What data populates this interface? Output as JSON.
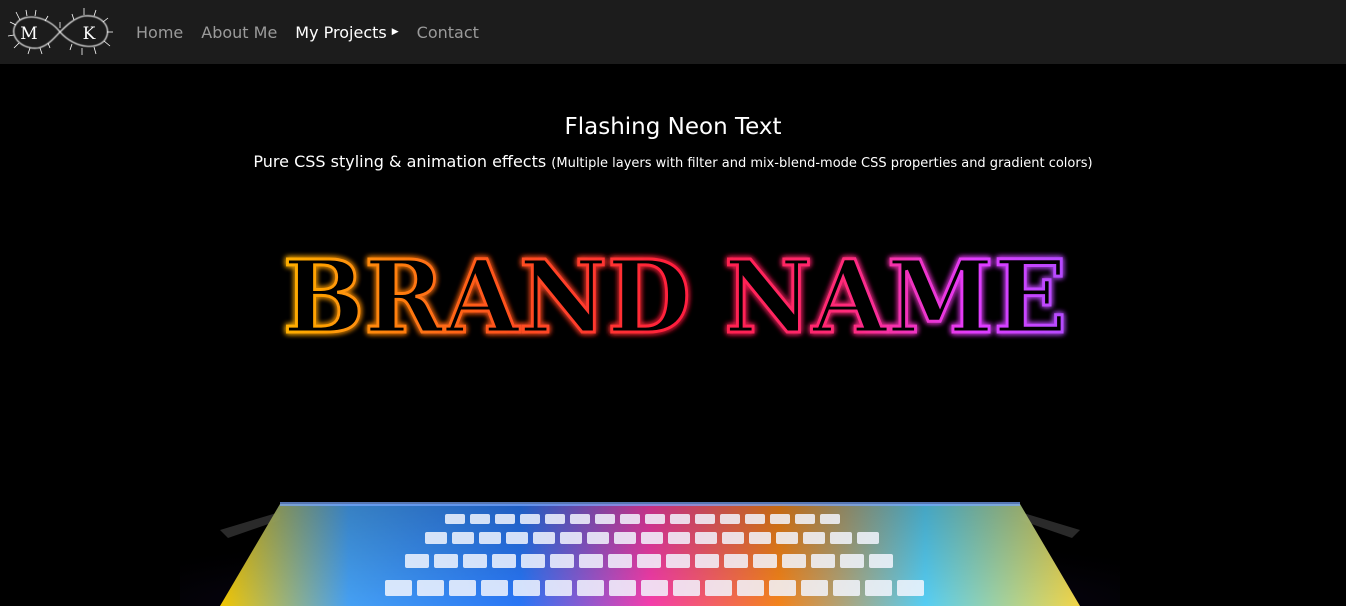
{
  "logo": {
    "letter_left": "M",
    "letter_right": "K"
  },
  "nav": {
    "items": [
      {
        "label": "Home",
        "active": false
      },
      {
        "label": "About Me",
        "active": false
      },
      {
        "label": "My Projects",
        "active": true,
        "has_caret": true
      },
      {
        "label": "Contact",
        "active": false
      }
    ],
    "caret_icon": "caret-right-icon"
  },
  "hero": {
    "title": "Flashing Neon Text",
    "subtitle_main": "Pure CSS styling & animation effects",
    "subtitle_detail": "(Multiple layers with filter and mix-blend-mode CSS properties and gradient colors)",
    "neon_text": "BRAND NAME",
    "neon_gradient": [
      "#ffb000",
      "#ff5a1a",
      "#ff1f3d",
      "#ff2a7a",
      "#e23cff",
      "#b44bff"
    ]
  },
  "colors": {
    "navbar_bg": "#1c1c1c",
    "page_bg": "#000000",
    "nav_text": "#9a9a9a",
    "nav_text_active": "#ffffff"
  }
}
